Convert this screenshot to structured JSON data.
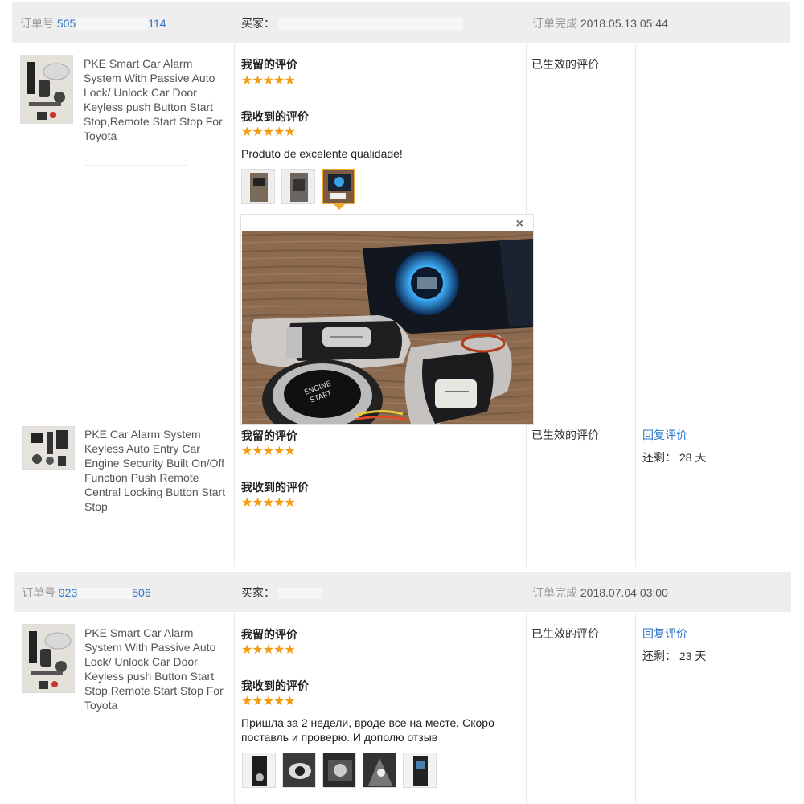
{
  "orders": [
    {
      "order_label": "订单号",
      "order_no_prefix": "505",
      "order_no_suffix": "114",
      "buyer_label": "买家：",
      "completed_label": "订单完成",
      "completed_time": "2018.05.13 05:44",
      "items": [
        {
          "title": "PKE Smart Car Alarm System With Passive Auto Lock/ Unlock Car Door Keyless push Button Start Stop,Remote Start Stop For Toyota",
          "my_eval_label": "我留的评价",
          "received_eval_label": "我收到的评价",
          "my_stars": 5,
          "received_stars": 5,
          "review": "Produto de excelente qualidade!",
          "status": "已生效的评价",
          "photo_count": 3,
          "selected_photo": 3,
          "close_symbol": "×"
        },
        {
          "title": "PKE Car Alarm System Keyless Auto Entry Car Engine Security Built On/Off Function Push Remote Central Locking Button Start Stop",
          "my_eval_label": "我留的评价",
          "received_eval_label": "我收到的评价",
          "my_stars": 5,
          "received_stars": 5,
          "status": "已生效的评价",
          "reply_label": "回复评价",
          "remaining_label": "还剩：",
          "remaining_value": "28 天"
        }
      ]
    },
    {
      "order_label": "订单号",
      "order_no_prefix": "923",
      "order_no_suffix": "506",
      "buyer_label": "买家：",
      "completed_label": "订单完成",
      "completed_time": "2018.07.04 03:00",
      "items": [
        {
          "title": "PKE Smart Car Alarm System With Passive Auto Lock/ Unlock Car Door Keyless push Button Start Stop,Remote Start Stop For Toyota",
          "my_eval_label": "我留的评价",
          "received_eval_label": "我收到的评价",
          "my_stars": 5,
          "received_stars": 5,
          "review": "Пришла за 2 недели, вроде все на месте. Скоро поставль и проверю. И дополю отзыв",
          "status": "已生效的评价",
          "reply_label": "回复评价",
          "remaining_label": "还剩：",
          "remaining_value": "23 天",
          "photo_count": 5
        }
      ]
    }
  ],
  "star_glyphs": "★★★★★",
  "colors": {
    "header_bg": "#eeeeee",
    "link": "#2f76c9",
    "star": "#f39c12",
    "selected_border": "#f0a830"
  }
}
